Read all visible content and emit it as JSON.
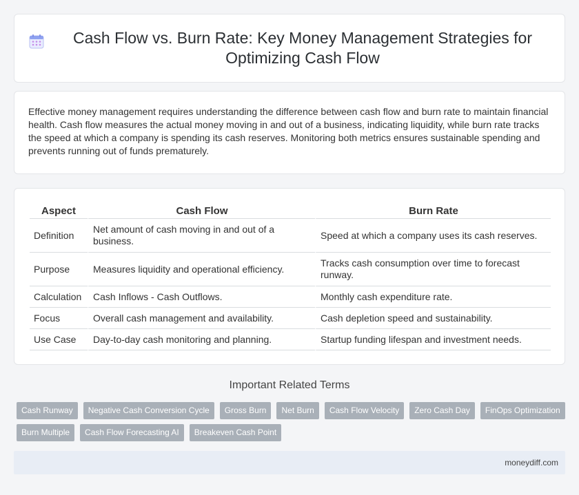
{
  "header": {
    "title": "Cash Flow vs. Burn Rate: Key Money Management Strategies for Optimizing Cash Flow",
    "icon": "calendar-icon"
  },
  "intro": {
    "text": "Effective money management requires understanding the difference between cash flow and burn rate to maintain financial health. Cash flow measures the actual money moving in and out of a business, indicating liquidity, while burn rate tracks the speed at which a company is spending its cash reserves. Monitoring both metrics ensures sustainable spending and prevents running out of funds prematurely."
  },
  "table": {
    "headers": [
      "Aspect",
      "Cash Flow",
      "Burn Rate"
    ],
    "rows": [
      [
        "Definition",
        "Net amount of cash moving in and out of a business.",
        "Speed at which a company uses its cash reserves."
      ],
      [
        "Purpose",
        "Measures liquidity and operational efficiency.",
        "Tracks cash consumption over time to forecast runway."
      ],
      [
        "Calculation",
        "Cash Inflows - Cash Outflows.",
        "Monthly cash expenditure rate."
      ],
      [
        "Focus",
        "Overall cash management and availability.",
        "Cash depletion speed and sustainability."
      ],
      [
        "Use Case",
        "Day-to-day cash monitoring and planning.",
        "Startup funding lifespan and investment needs."
      ]
    ]
  },
  "related": {
    "title": "Important Related Terms",
    "tags": [
      "Cash Runway",
      "Negative Cash Conversion Cycle",
      "Gross Burn",
      "Net Burn",
      "Cash Flow Velocity",
      "Zero Cash Day",
      "FinOps Optimization",
      "Burn Multiple",
      "Cash Flow Forecasting AI",
      "Breakeven Cash Point"
    ]
  },
  "footer": {
    "site": "moneydiff.com"
  },
  "colors": {
    "tag_bg": "#a9b0b8",
    "footer_bg": "#e8edf5",
    "icon_accent": "#8a7fe0"
  }
}
